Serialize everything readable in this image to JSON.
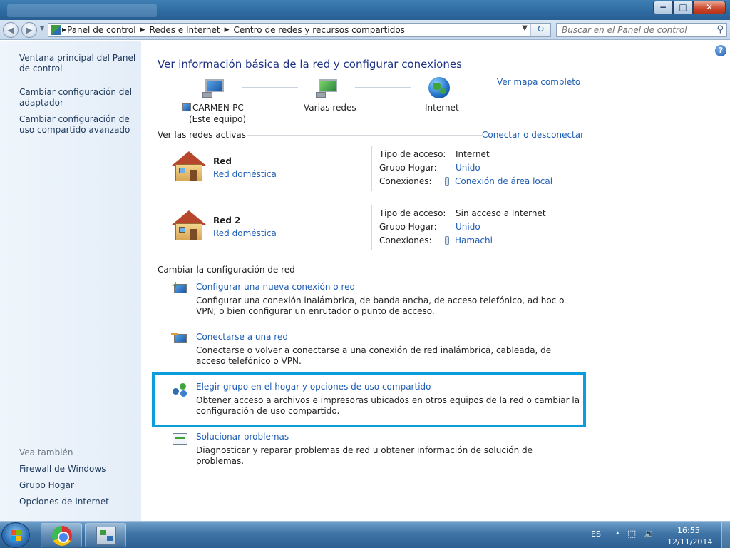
{
  "window": {
    "minimize_icon": "minimize-icon",
    "maximize_icon": "maximize-icon",
    "close_icon": "close-icon",
    "minimize_glyph": "−",
    "maximize_glyph": "□",
    "close_glyph": "✕"
  },
  "navbar": {
    "back_glyph": "◀",
    "forward_glyph": "▶",
    "breadcrumbs": [
      "Panel de control",
      "Redes e Internet",
      "Centro de redes y recursos compartidos"
    ],
    "breadcrumb_sep": "▶",
    "dropdown_glyph": "▼",
    "refresh_glyph": "↻",
    "search_placeholder": "Buscar en el Panel de control",
    "search_glyph": "⚲"
  },
  "sidebar": {
    "links": [
      "Ventana principal del Panel de control",
      "Cambiar configuración del adaptador",
      "Cambiar configuración de uso compartido avanzado"
    ],
    "see_also_label": "Vea también",
    "see_also": [
      "Firewall de Windows",
      "Grupo Hogar",
      "Opciones de Internet"
    ]
  },
  "main": {
    "help_glyph": "?",
    "title": "Ver información básica de la red y configurar conexiones",
    "full_map_link": "Ver mapa completo",
    "map": {
      "computer_name": "CARMEN-PC",
      "computer_sub": "(Este equipo)",
      "middle": "Varias redes",
      "internet": "Internet"
    },
    "active_label": "Ver las redes activas",
    "connect_link": "Conectar o desconectar",
    "networks": [
      {
        "name": "Red",
        "type": "Red doméstica",
        "access_label": "Tipo de acceso:",
        "access": "Internet",
        "homegroup_label": "Grupo Hogar:",
        "homegroup": "Unido",
        "connections_label": "Conexiones:",
        "connection": "Conexión de área local"
      },
      {
        "name": "Red  2",
        "type": "Red doméstica",
        "access_label": "Tipo de acceso:",
        "access": "Sin acceso a Internet",
        "homegroup_label": "Grupo Hogar:",
        "homegroup": "Unido",
        "connections_label": "Conexiones:",
        "connection": "Hamachi"
      }
    ],
    "change_label": "Cambiar la configuración de red",
    "tasks": [
      {
        "title": "Configurar una nueva conexión o red",
        "desc": "Configurar una conexión inalámbrica, de banda ancha, de acceso telefónico, ad hoc o VPN; o bien configurar un enrutador o punto de acceso."
      },
      {
        "title": "Conectarse a una red",
        "desc": "Conectarse o volver a conectarse a una conexión de red inalámbrica, cableada, de acceso telefónico o VPN."
      },
      {
        "title": "Elegir grupo en el hogar y opciones de uso compartido",
        "desc": "Obtener acceso a archivos e impresoras ubicados en otros equipos de la red o cambiar la configuración de uso compartido."
      },
      {
        "title": "Solucionar problemas",
        "desc": "Diagnosticar y reparar problemas de red u obtener información de solución de problemas."
      }
    ]
  },
  "taskbar": {
    "language": "ES",
    "time": "16:55",
    "date": "12/11/2014",
    "network_glyph": "⬚",
    "volume_glyph": "🔉",
    "tray_arrow": "▴"
  },
  "colors": {
    "link": "#1e5db4",
    "heading": "#1e3287",
    "highlight": "#0b9ddb"
  }
}
